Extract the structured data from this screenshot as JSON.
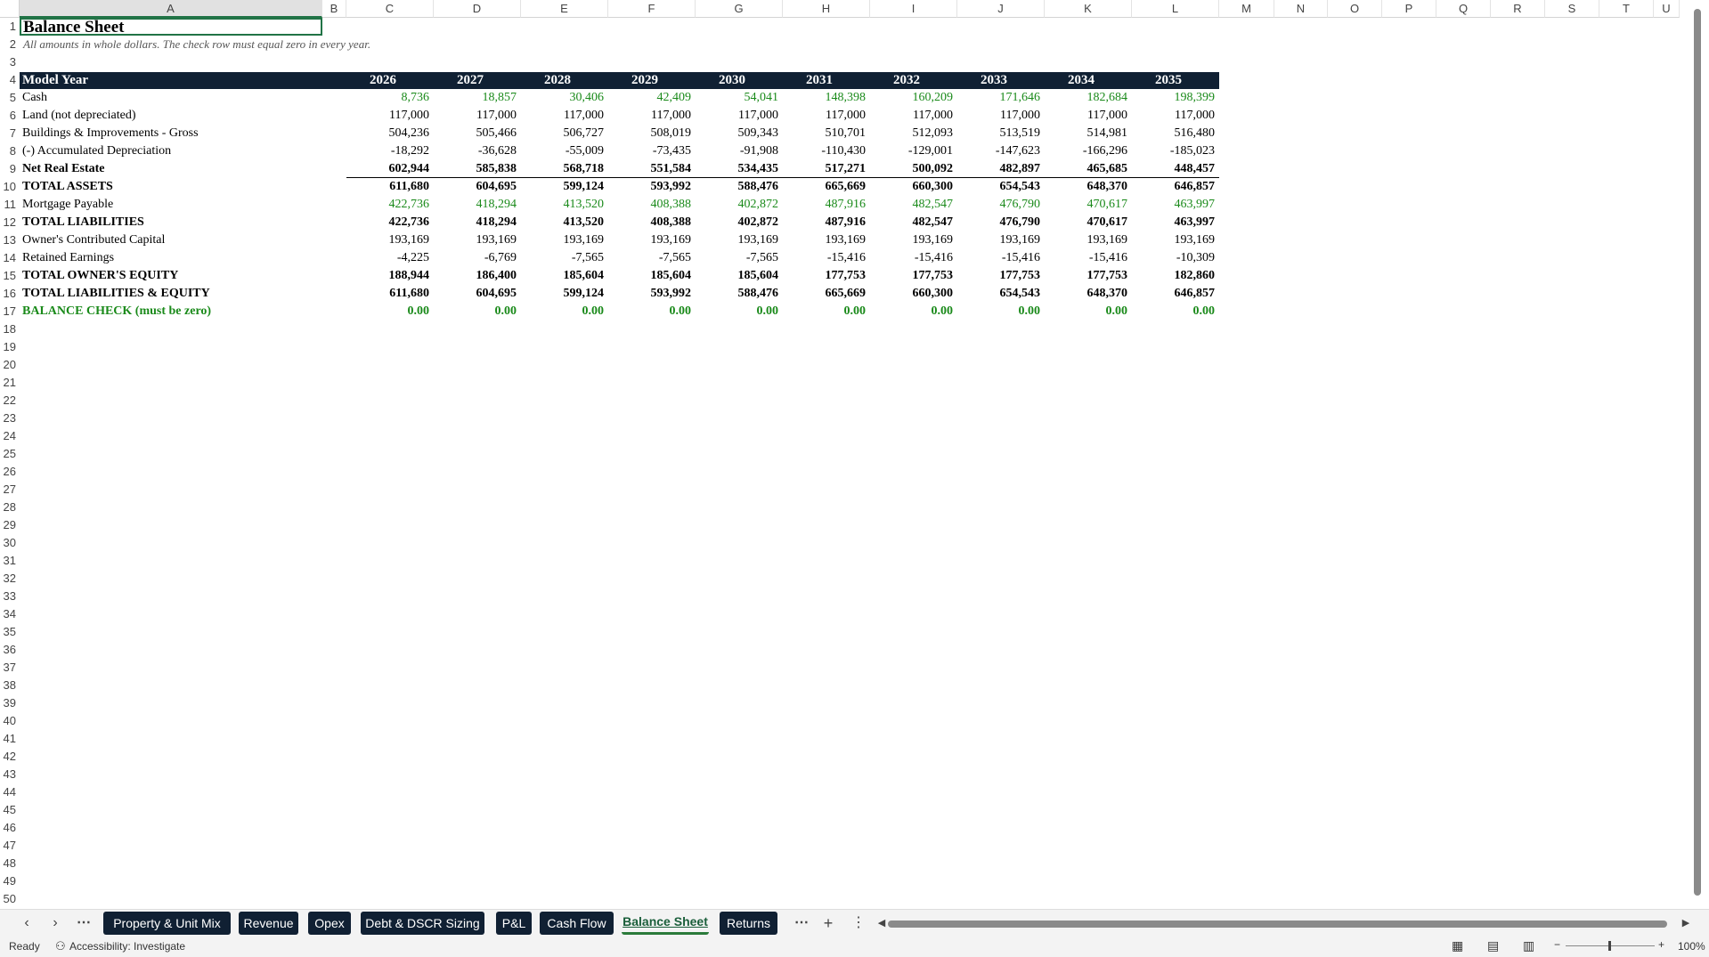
{
  "columns": [
    "A",
    "B",
    "C",
    "D",
    "E",
    "F",
    "G",
    "H",
    "I",
    "J",
    "K",
    "L",
    "M",
    "N",
    "O",
    "P",
    "Q",
    "R",
    "S",
    "T",
    "U"
  ],
  "rows": [
    "1",
    "2",
    "3",
    "4",
    "5",
    "6",
    "7",
    "8",
    "9",
    "10",
    "11",
    "12",
    "13",
    "14",
    "15",
    "16",
    "17",
    "18",
    "19",
    "20",
    "21",
    "22",
    "23",
    "24",
    "25",
    "26",
    "27",
    "28",
    "29",
    "30",
    "31",
    "32",
    "33",
    "34",
    "35",
    "36",
    "37",
    "38",
    "39",
    "40",
    "41",
    "42",
    "43",
    "44",
    "45",
    "46",
    "47",
    "48",
    "49",
    "50"
  ],
  "title": "Balance Sheet",
  "subtitle": "All amounts in whole dollars. The check row must equal zero in every year.",
  "header_label": "Model Year",
  "years": [
    "2026",
    "2027",
    "2028",
    "2029",
    "2030",
    "2031",
    "2032",
    "2033",
    "2034",
    "2035"
  ],
  "lines": [
    {
      "label": "Cash",
      "bold": false,
      "green": true,
      "values": [
        "8,736",
        "18,857",
        "30,406",
        "42,409",
        "54,041",
        "148,398",
        "160,209",
        "171,646",
        "182,684",
        "198,399"
      ]
    },
    {
      "label": "Land (not depreciated)",
      "bold": false,
      "green": false,
      "values": [
        "117,000",
        "117,000",
        "117,000",
        "117,000",
        "117,000",
        "117,000",
        "117,000",
        "117,000",
        "117,000",
        "117,000"
      ]
    },
    {
      "label": "Buildings & Improvements - Gross",
      "bold": false,
      "green": false,
      "values": [
        "504,236",
        "505,466",
        "506,727",
        "508,019",
        "509,343",
        "510,701",
        "512,093",
        "513,519",
        "514,981",
        "516,480"
      ]
    },
    {
      "label": "(-) Accumulated Depreciation",
      "bold": false,
      "green": false,
      "values": [
        "-18,292",
        "-36,628",
        "-55,009",
        "-73,435",
        "-91,908",
        "-110,430",
        "-129,001",
        "-147,623",
        "-166,296",
        "-185,023"
      ]
    },
    {
      "label": "Net Real Estate",
      "bold": true,
      "green": false,
      "values": [
        "602,944",
        "585,838",
        "568,718",
        "551,584",
        "534,435",
        "517,271",
        "500,092",
        "482,897",
        "465,685",
        "448,457"
      ]
    },
    {
      "label": "TOTAL ASSETS",
      "bold": true,
      "green": false,
      "values": [
        "611,680",
        "604,695",
        "599,124",
        "593,992",
        "588,476",
        "665,669",
        "660,300",
        "654,543",
        "648,370",
        "646,857"
      ]
    },
    {
      "label": "Mortgage Payable",
      "bold": false,
      "green": true,
      "values": [
        "422,736",
        "418,294",
        "413,520",
        "408,388",
        "402,872",
        "487,916",
        "482,547",
        "476,790",
        "470,617",
        "463,997"
      ]
    },
    {
      "label": "TOTAL LIABILITIES",
      "bold": true,
      "green": false,
      "values": [
        "422,736",
        "418,294",
        "413,520",
        "408,388",
        "402,872",
        "487,916",
        "482,547",
        "476,790",
        "470,617",
        "463,997"
      ]
    },
    {
      "label": "Owner's Contributed Capital",
      "bold": false,
      "green": false,
      "values": [
        "193,169",
        "193,169",
        "193,169",
        "193,169",
        "193,169",
        "193,169",
        "193,169",
        "193,169",
        "193,169",
        "193,169"
      ]
    },
    {
      "label": "Retained Earnings",
      "bold": false,
      "green": false,
      "values": [
        "-4,225",
        "-6,769",
        "-7,565",
        "-7,565",
        "-7,565",
        "-15,416",
        "-15,416",
        "-15,416",
        "-15,416",
        "-10,309"
      ]
    },
    {
      "label": "TOTAL OWNER'S EQUITY",
      "bold": true,
      "green": false,
      "values": [
        "188,944",
        "186,400",
        "185,604",
        "185,604",
        "185,604",
        "177,753",
        "177,753",
        "177,753",
        "177,753",
        "182,860"
      ]
    },
    {
      "label": "TOTAL LIABILITIES & EQUITY",
      "bold": true,
      "green": false,
      "values": [
        "611,680",
        "604,695",
        "599,124",
        "593,992",
        "588,476",
        "665,669",
        "660,300",
        "654,543",
        "648,370",
        "646,857"
      ]
    },
    {
      "label": "BALANCE CHECK (must be zero)",
      "bold": true,
      "green": true,
      "values": [
        "0.00",
        "0.00",
        "0.00",
        "0.00",
        "0.00",
        "0.00",
        "0.00",
        "0.00",
        "0.00",
        "0.00"
      ]
    }
  ],
  "tabs": [
    "Property & Unit Mix",
    "Revenue",
    "Opex",
    "Debt & DSCR Sizing",
    "P&L",
    "Cash Flow",
    "Balance Sheet",
    "Returns"
  ],
  "active_tab": "Balance Sheet",
  "status": {
    "ready": "Ready",
    "accessibility": "Accessibility: Investigate",
    "zoom": "100%"
  },
  "colors": {
    "header_band": "#102033",
    "green": "#1a8a1a",
    "selection": "#217346"
  }
}
